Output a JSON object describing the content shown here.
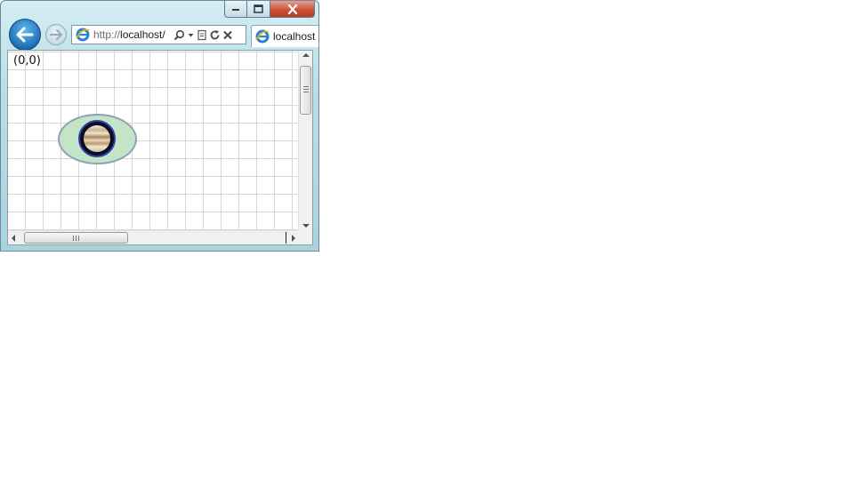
{
  "browser": {
    "address_bar": {
      "url_scheme": "http://",
      "url_host": "localhost/"
    },
    "tab": {
      "label": "localhost"
    },
    "icons": {
      "back": "back-arrow-icon",
      "forward": "forward-arrow-icon",
      "site": "internet-explorer-icon",
      "search": "search-icon",
      "dropdown": "dropdown-arrow-icon",
      "compat": "compatibility-view-icon",
      "refresh": "refresh-icon",
      "stop": "stop-icon",
      "minimize": "minimize-icon",
      "maximize": "maximize-icon",
      "close": "close-icon"
    }
  },
  "page": {
    "origin_label": "(0,0)"
  },
  "colors": {
    "orbit_fill": "#c3e4c6",
    "orbit_stroke": "#8ea1b6",
    "planet_ring": "#2f3fa8",
    "grid_line": "#d6d6d6",
    "close_button": "#c74f35",
    "back_button": "#1f6fb5"
  }
}
